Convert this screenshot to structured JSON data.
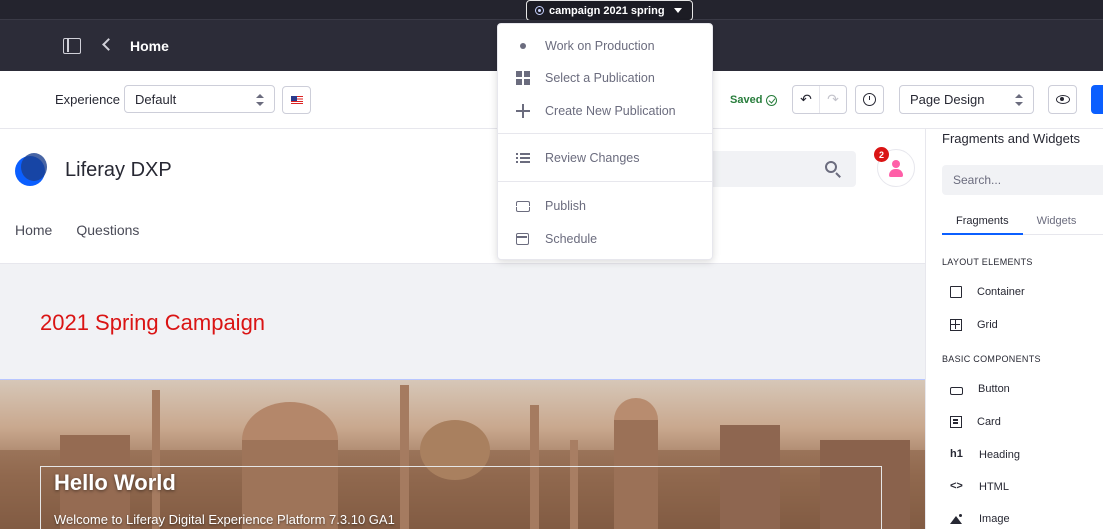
{
  "publication": {
    "name": "campaign 2021 spring"
  },
  "control": {
    "page_name": "Home"
  },
  "toolbar": {
    "experience_label": "Experience",
    "experience_value": "Default",
    "saved_label": "Saved",
    "mode_value": "Page Design"
  },
  "site": {
    "name": "Liferay DXP",
    "notification_count": "2",
    "nav": [
      "Home",
      "Questions"
    ],
    "campaign_title": "2021 Spring Campaign",
    "hero_title": "Hello World",
    "hero_subtitle": "Welcome to Liferay Digital Experience Platform 7.3.10 GA1"
  },
  "sidebar": {
    "title": "Fragments and Widgets",
    "search_placeholder": "Search...",
    "tabs": [
      "Fragments",
      "Widgets"
    ],
    "sections": [
      {
        "title": "LAYOUT ELEMENTS",
        "items": [
          "Container",
          "Grid"
        ]
      },
      {
        "title": "BASIC COMPONENTS",
        "items": [
          "Button",
          "Card",
          "Heading",
          "HTML",
          "Image"
        ]
      }
    ]
  },
  "menu": {
    "items": [
      "Work on Production",
      "Select a Publication",
      "Create New Publication",
      "Review Changes",
      "Publish",
      "Schedule"
    ]
  },
  "colors": {
    "primary": "#0b5fff",
    "campaign_red": "#da1414",
    "saved_green": "#287d3c",
    "control_bg": "#2c2c38"
  }
}
